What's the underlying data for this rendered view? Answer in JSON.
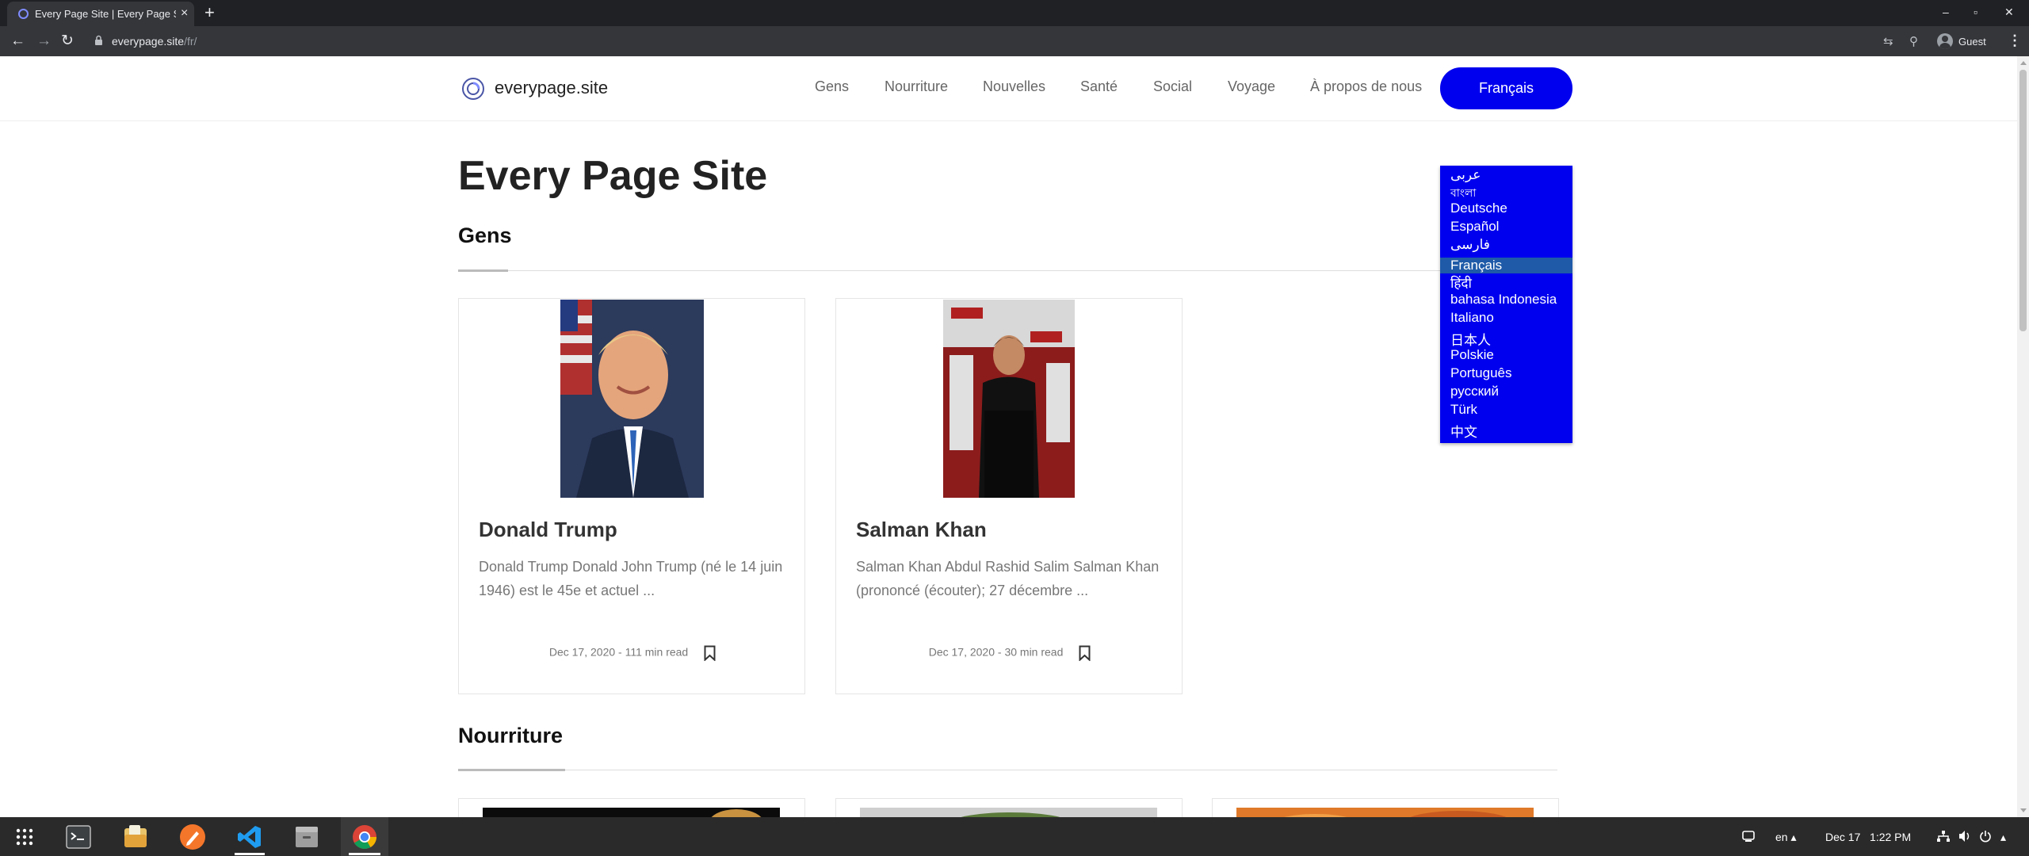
{
  "browser": {
    "tab_title": "Every Page Site | Every Page Site",
    "url_host": "everypage.site",
    "url_path": "/fr/",
    "profile": "Guest",
    "close_glyph": "×",
    "new_tab_glyph": "+",
    "back_glyph": "←",
    "forward_glyph": "→",
    "reload_glyph": "↻",
    "menu_glyph": "⋮",
    "minimize_glyph": "–",
    "maximize_glyph": "▫",
    "close_window_glyph": "✕",
    "translate_glyph": "⇆",
    "zoom_glyph": "⚲"
  },
  "site": {
    "logo_text": "everypage.site",
    "nav": [
      "Gens",
      "Nourriture",
      "Nouvelles",
      "Santé",
      "Social",
      "Voyage",
      "À propos de nous"
    ],
    "lang_button": "Français",
    "languages": [
      "عربى",
      "বাংলা",
      "Deutsche",
      "Español",
      "فارسی",
      "Français",
      "हिंदी",
      "bahasa Indonesia",
      "Italiano",
      "日本人",
      "Polskie",
      "Português",
      "русский",
      "Türk",
      "中文"
    ],
    "selected_language": "Français",
    "page_title": "Every Page Site",
    "sections": {
      "people": "Gens",
      "food": "Nourriture"
    },
    "cards": [
      {
        "name": "Donald Trump",
        "excerpt": "Donald Trump Donald John Trump (né le 14 juin 1946) est le 45e et actuel ...",
        "meta": "Dec 17, 2020 - 111 min read"
      },
      {
        "name": "Salman Khan",
        "excerpt": "Salman Khan Abdul Rashid Salim Salman Khan (prononcé (écouter); 27 décembre ...",
        "meta": "Dec 17, 2020 - 30 min read"
      }
    ]
  },
  "taskbar": {
    "language": "en",
    "date": "Dec 17",
    "time": "1:22 PM",
    "caret": "▴",
    "apps": [
      "app-grid",
      "terminal",
      "files",
      "pen-app",
      "vscode",
      "file-manager",
      "chrome"
    ]
  },
  "colors": {
    "accent": "#0000ee",
    "selected_lang": "#1e5aa8",
    "chrome_dark": "#202124",
    "chrome_toolbar": "#35363a",
    "taskbar": "#2a2a2a"
  }
}
